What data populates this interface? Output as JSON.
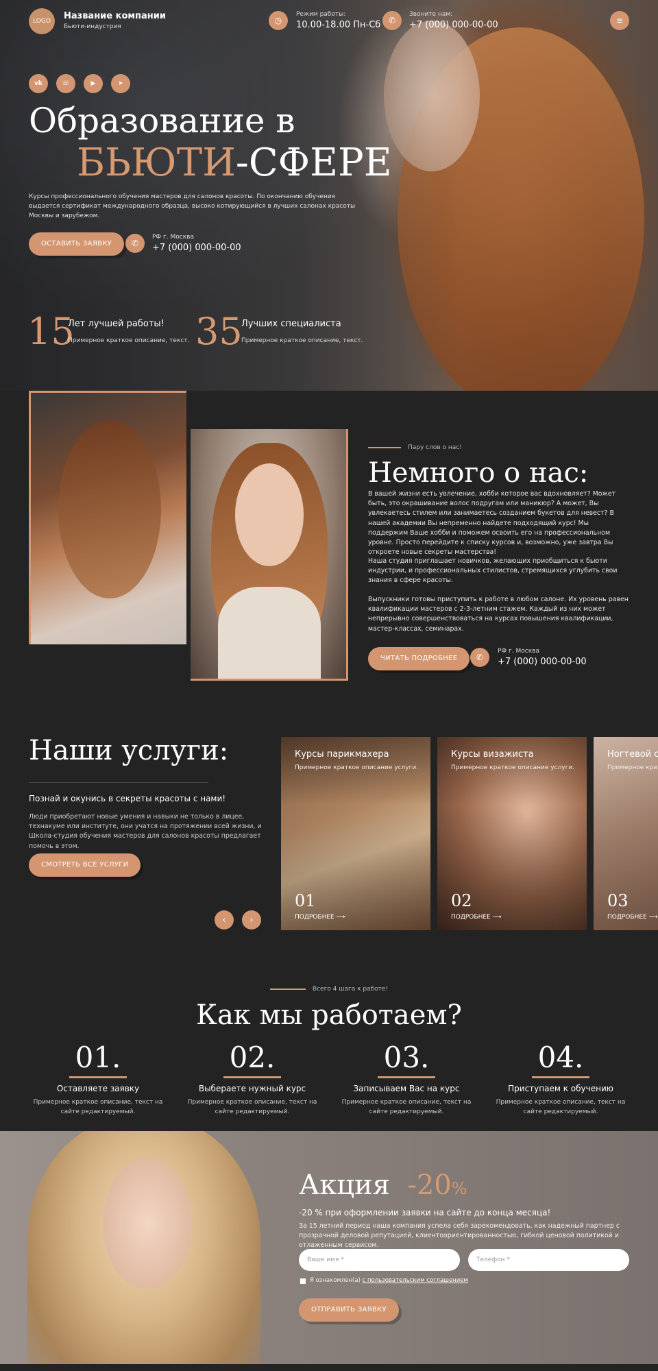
{
  "header": {
    "logo": "LOGO",
    "company_name": "Название компании",
    "company_sub": "Бьюти-индустрия",
    "hours_label": "Режим работы:",
    "hours_value": "10.00-18.00 Пн-Сб",
    "call_label": "Звоните нам:",
    "call_value": "+7 (000) 000-00-00"
  },
  "social": [
    "vk",
    "whatsapp",
    "youtube",
    "telegram"
  ],
  "hero": {
    "title_line1": "Образование в",
    "title_accent": "БЬЮТИ",
    "title_rest": "-СФЕРЕ",
    "description": "Курсы профессионального обучения мастеров для салонов красоты. По окончанию обучения выдается сертификат международного образца, высоко котирующийся в лучших салонах красоты Москвы и зарубежом.",
    "cta": "ОСТАВИТЬ ЗАЯВКУ",
    "phone_label": "РФ г. Москва",
    "phone": "+7 (000) 000-00-00",
    "stats": [
      {
        "num": "15",
        "title": "Лет лучшей работы!",
        "desc": "Примерное краткое описание, текст."
      },
      {
        "num": "35",
        "title": "Лучших специалиста",
        "desc": "Примерное краткое описание, текст."
      }
    ]
  },
  "about": {
    "eyebrow": "Пару слов о нас!",
    "title": "Немного о нас:",
    "p1": "В вашей жизни есть увлечение, хобби которое вас вдохновляет? Может быть, это окрашивание волос подругам или маникюр? А может, Вы увлекаетесь стилем или занимаетесь созданием букетов для невест? В нашей академии Вы непременно найдете подходящий курс! Мы поддержим Ваше хобби и поможем освоить его на профессиональном уровне. Просто перейдите к списку курсов и, возможно, уже завтра Вы откроете новые секреты мастерства!",
    "p2": "Наша студия приглашает новичков, желающих приобщиться к бьюти индустрии, и профессиональных стилистов, стремящихся углубить свои знания в сфере красоты.",
    "p3": "Выпускники готовы приступить к работе в любом салоне. Их уровень равен квалификации мастеров с 2-3-летним стажем. Каждый из них может непрерывно совершенствоваться на курсах повышения квалификации, мастер-классах, семинарах.",
    "cta": "ЧИТАТЬ ПОДРОБНЕЕ",
    "phone_label": "РФ г. Москва",
    "phone": "+7 (000) 000-00-00"
  },
  "services": {
    "title": "Наши услуги:",
    "subtitle": "Познай и окунись в секреты красоты с нами!",
    "description": "Люди приобретают новые умения и навыки не только в лицее, технакуме или институте, они учатся на протяжении всей жизни, и Школа-студия обучения мастеров для салонов красоты предлагает помочь в этом.",
    "cta": "СМОТРЕТЬ ВСЕ УСЛУГИ",
    "cards": [
      {
        "title": "Курсы парикмахера",
        "desc": "Примерное краткое описание услуги.",
        "num": "01",
        "more": "ПОДРОБНЕЕ"
      },
      {
        "title": "Курсы визажиста",
        "desc": "Примерное краткое описание услуги.",
        "num": "02",
        "more": "ПОДРОБНЕЕ"
      },
      {
        "title": "Ногтевой сервис",
        "desc": "Примерное краткое описание услуги.",
        "num": "03",
        "more": "ПОДРОБНЕЕ"
      }
    ]
  },
  "steps": {
    "eyebrow": "Всего 4 шага к работе!",
    "title": "Как мы работаем?",
    "items": [
      {
        "num": "01.",
        "title": "Оставляете заявку",
        "desc": "Примерное краткое описание, текст на сайте редактируемый."
      },
      {
        "num": "02.",
        "title": "Выбераете нужный курс",
        "desc": "Примерное краткое описание, текст на сайте редактируемый."
      },
      {
        "num": "03.",
        "title": "Записываем Вас на курс",
        "desc": "Примерное краткое описание, текст на сайте редактируемый."
      },
      {
        "num": "04.",
        "title": "Приступаем к обучению",
        "desc": "Примерное краткое описание, текст на сайте редактируемый."
      }
    ]
  },
  "promo": {
    "title": "Акция",
    "discount": "-20",
    "percent": "%",
    "subtitle": "-20 % при оформлении заявки на сайте до конца месяца!",
    "description": "За 15 летний период наша компания успела себя зарекомендовать, как надежный партнер с прозрачной деловой репутацией, клиентоориентированностью, гибкой ценовой политикой и отлаженным сервисом.",
    "name_placeholder": "Ваше имя *",
    "phone_placeholder": "Телефон *",
    "agree_text": "Я ознакомлен(а)",
    "agree_link": "с пользовательским соглашением",
    "cta": "ОТПРАВИТЬ ЗАЯВКУ"
  },
  "colors": {
    "accent": "#d39670",
    "dark": "#232323"
  }
}
